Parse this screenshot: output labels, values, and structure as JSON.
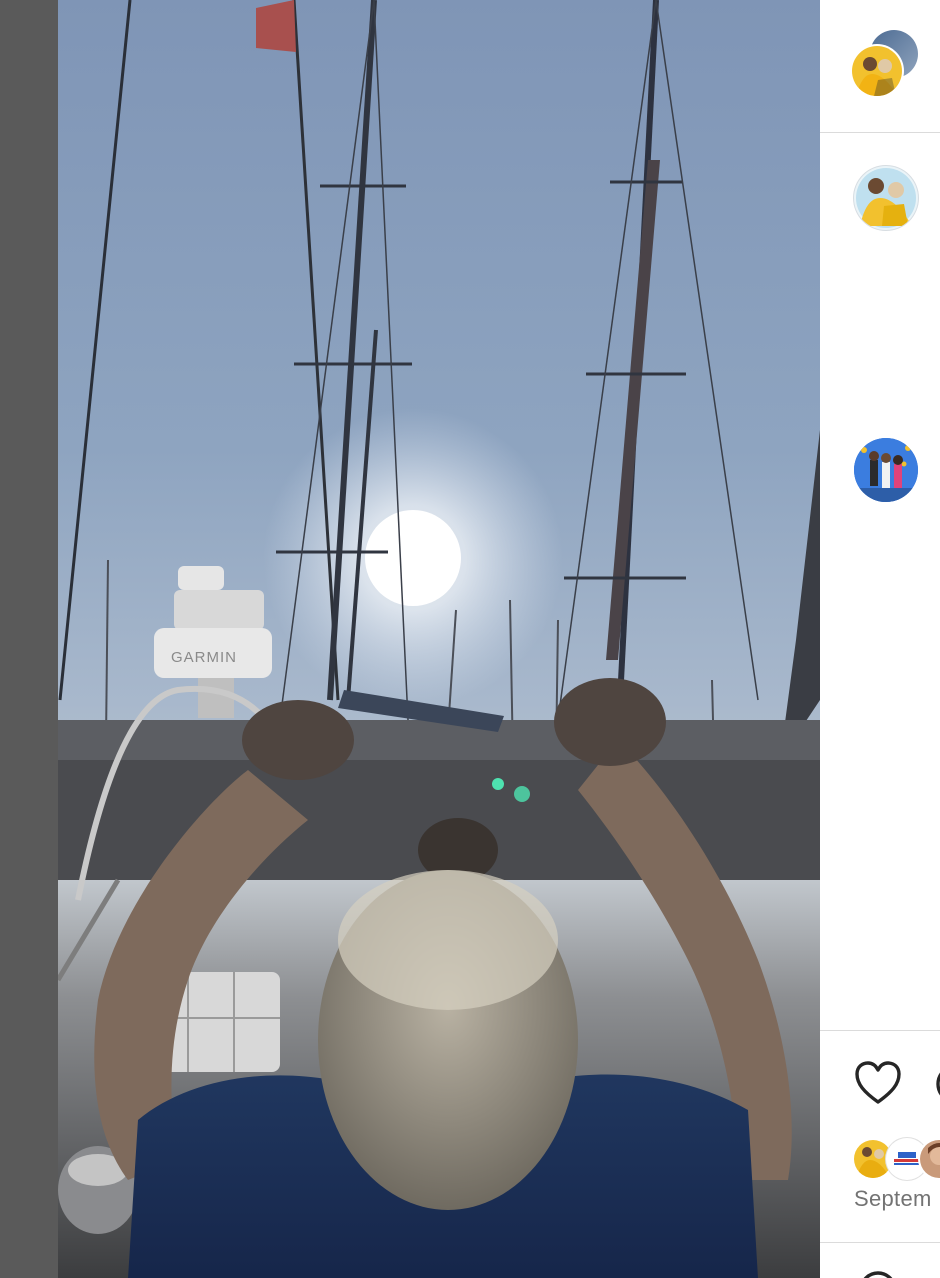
{
  "post": {
    "date_partial": "Septem",
    "photo": {
      "alt": "",
      "sign_text": "GARMIN"
    }
  },
  "panel": {
    "header_avatars": [
      "author-avatar-back",
      "author-avatar-front"
    ],
    "comments": [
      {
        "avatar": "sailor-couple-avatar"
      },
      {
        "avatar": "group-photo-avatar"
      }
    ],
    "likes_avatars": [
      "liker-avatar-1",
      "liker-avatar-2",
      "liker-avatar-3"
    ]
  },
  "icons": {
    "like": "heart-icon",
    "comment": "comment-icon"
  },
  "colors": {
    "avatar_yellow": "#f2c12e",
    "date_gray": "#737373",
    "divider": "#dbdbdb"
  }
}
